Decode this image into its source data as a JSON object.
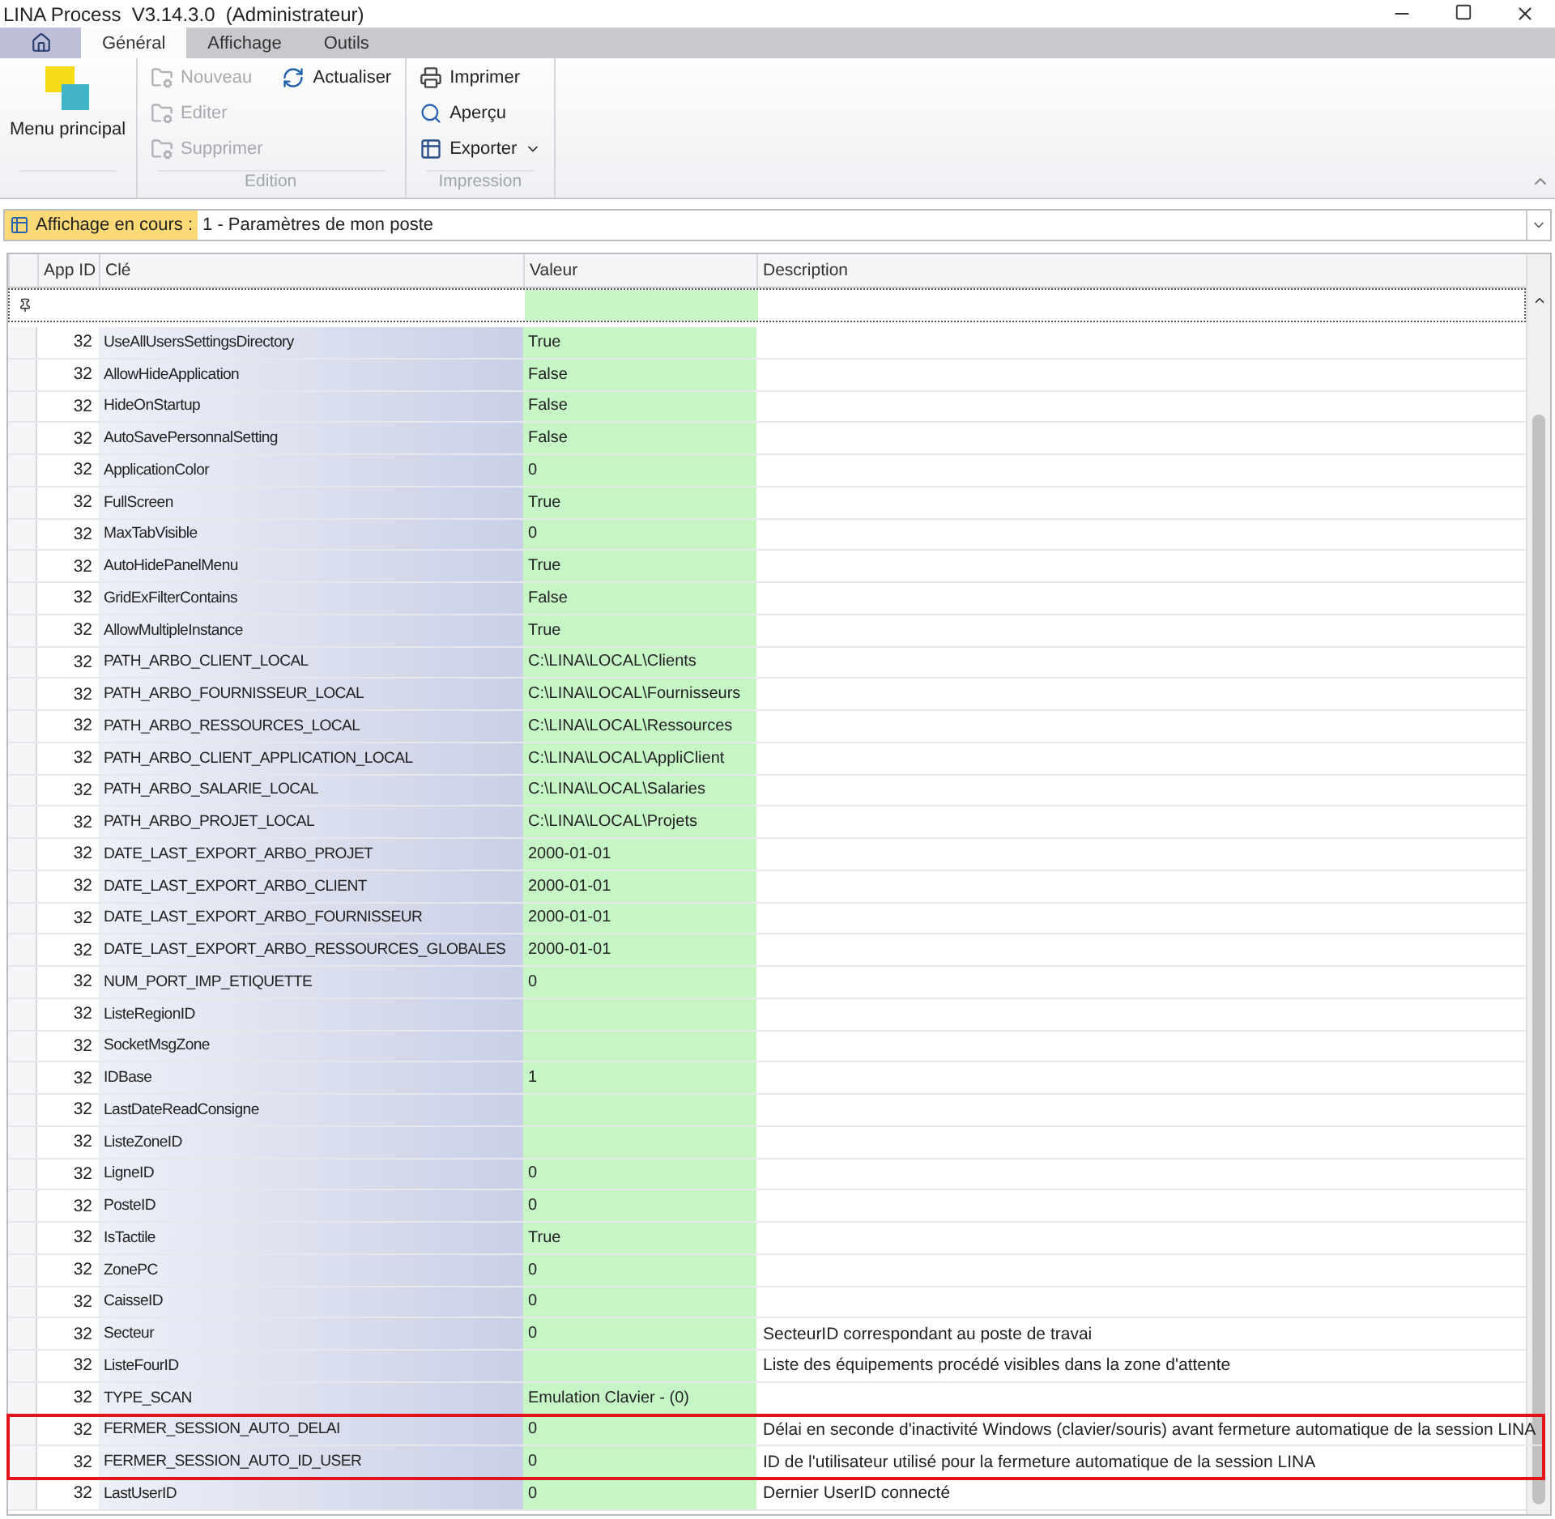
{
  "window": {
    "title": "LINA Process  V3.14.3.0  (Administrateur)"
  },
  "tabs": [
    {
      "label": "Général",
      "selected": true
    },
    {
      "label": "Affichage",
      "selected": false
    },
    {
      "label": "Outils",
      "selected": false
    }
  ],
  "ribbon": {
    "groups": [
      {
        "buttons": [
          {
            "kind": "large",
            "label": "Menu principal",
            "disabled": false
          }
        ]
      },
      {
        "caption": "Edition",
        "buttons": [
          {
            "kind": "small",
            "label": "Nouveau",
            "disabled": true
          },
          {
            "kind": "small",
            "label": "Editer",
            "disabled": true
          },
          {
            "kind": "small",
            "label": "Supprimer",
            "disabled": true
          },
          {
            "kind": "small",
            "label": "Actualiser",
            "disabled": false
          }
        ]
      },
      {
        "caption": "Impression",
        "buttons": [
          {
            "kind": "small",
            "label": "Imprimer",
            "disabled": false
          },
          {
            "kind": "small",
            "label": "Aperçu",
            "disabled": false
          },
          {
            "kind": "small",
            "label": "Exporter",
            "disabled": false,
            "dropdown": true
          }
        ]
      }
    ]
  },
  "view_bar": {
    "label": "Affichage en cours :",
    "value": "1 - Paramètres de mon poste"
  },
  "table": {
    "columns": [
      "App ID",
      "Clé",
      "Valeur",
      "Description"
    ],
    "rows": [
      {
        "app_id": "32",
        "key": "UseAllUsersSettingsDirectory",
        "value": "True",
        "highlighted": false
      },
      {
        "app_id": "32",
        "key": "AllowHideApplication",
        "value": "False",
        "highlighted": false
      },
      {
        "app_id": "32",
        "key": "HideOnStartup",
        "value": "False",
        "highlighted": false
      },
      {
        "app_id": "32",
        "key": "AutoSavePersonnalSetting",
        "value": "False",
        "highlighted": false
      },
      {
        "app_id": "32",
        "key": "ApplicationColor",
        "value": "0",
        "highlighted": false
      },
      {
        "app_id": "32",
        "key": "FullScreen",
        "value": "True",
        "highlighted": false
      },
      {
        "app_id": "32",
        "key": "MaxTabVisible",
        "value": "0",
        "highlighted": false
      },
      {
        "app_id": "32",
        "key": "AutoHidePanelMenu",
        "value": "True",
        "highlighted": false
      },
      {
        "app_id": "32",
        "key": "GridExFilterContains",
        "value": "False",
        "highlighted": false
      },
      {
        "app_id": "32",
        "key": "AllowMultipleInstance",
        "value": "True",
        "highlighted": false
      },
      {
        "app_id": "32",
        "key": "PATH_ARBO_CLIENT_LOCAL",
        "value": "C:\\LINA\\LOCAL\\Clients",
        "highlighted": false
      },
      {
        "app_id": "32",
        "key": "PATH_ARBO_FOURNISSEUR_LOCAL",
        "value": "C:\\LINA\\LOCAL\\Fournisseurs",
        "highlighted": false
      },
      {
        "app_id": "32",
        "key": "PATH_ARBO_RESSOURCES_LOCAL",
        "value": "C:\\LINA\\LOCAL\\Ressources",
        "highlighted": false
      },
      {
        "app_id": "32",
        "key": "PATH_ARBO_CLIENT_APPLICATION_LOCAL",
        "value": "C:\\LINA\\LOCAL\\AppliClient",
        "highlighted": false
      },
      {
        "app_id": "32",
        "key": "PATH_ARBO_SALARIE_LOCAL",
        "value": "C:\\LINA\\LOCAL\\Salaries",
        "highlighted": false
      },
      {
        "app_id": "32",
        "key": "PATH_ARBO_PROJET_LOCAL",
        "value": "C:\\LINA\\LOCAL\\Projets",
        "highlighted": false
      },
      {
        "app_id": "32",
        "key": "DATE_LAST_EXPORT_ARBO_PROJET",
        "value": "2000-01-01",
        "highlighted": false
      },
      {
        "app_id": "32",
        "key": "DATE_LAST_EXPORT_ARBO_CLIENT",
        "value": "2000-01-01",
        "highlighted": false
      },
      {
        "app_id": "32",
        "key": "DATE_LAST_EXPORT_ARBO_FOURNISSEUR",
        "value": "2000-01-01",
        "highlighted": false
      },
      {
        "app_id": "32",
        "key": "DATE_LAST_EXPORT_ARBO_RESSOURCES_GLOBALES",
        "value": "2000-01-01",
        "highlighted": false
      },
      {
        "app_id": "32",
        "key": "NUM_PORT_IMP_ETIQUETTE",
        "value": "0",
        "highlighted": false
      },
      {
        "app_id": "32",
        "key": "ListeRegionID",
        "highlighted": false
      },
      {
        "app_id": "32",
        "key": "SocketMsgZone",
        "highlighted": false
      },
      {
        "app_id": "32",
        "key": "IDBase",
        "value": "1",
        "highlighted": false
      },
      {
        "app_id": "32",
        "key": "LastDateReadConsigne",
        "highlighted": false
      },
      {
        "app_id": "32",
        "key": "ListeZoneID",
        "highlighted": false
      },
      {
        "app_id": "32",
        "key": "LigneID",
        "value": "0",
        "highlighted": false
      },
      {
        "app_id": "32",
        "key": "PosteID",
        "value": "0",
        "highlighted": false
      },
      {
        "app_id": "32",
        "key": "IsTactile",
        "value": "True",
        "highlighted": false
      },
      {
        "app_id": "32",
        "key": "ZonePC",
        "value": "0",
        "highlighted": false
      },
      {
        "app_id": "32",
        "key": "CaisseID",
        "value": "0",
        "highlighted": false
      },
      {
        "app_id": "32",
        "key": "Secteur",
        "value": "0",
        "description": "SecteurID correspondant au poste de travai",
        "highlighted": false
      },
      {
        "app_id": "32",
        "key": "ListeFourID",
        "description": "Liste des équipements procédé visibles dans la zone d'attente",
        "highlighted": false
      },
      {
        "app_id": "32",
        "key": "TYPE_SCAN",
        "value": "Emulation Clavier - (0)",
        "highlighted": false
      },
      {
        "app_id": "32",
        "key": "FERMER_SESSION_AUTO_DELAI",
        "value": "0",
        "description": "Délai en seconde d'inactivité Windows (clavier/souris) avant fermeture automatique de la session LINA",
        "highlighted": true
      },
      {
        "app_id": "32",
        "key": "FERMER_SESSION_AUTO_ID_USER",
        "value": "0",
        "description": "ID de l'utilisateur utilisé pour la fermeture automatique de la session LINA",
        "highlighted": true
      },
      {
        "app_id": "32",
        "key": "LastUserID",
        "value": "0",
        "description": "Dernier UserID connecté",
        "highlighted": false
      }
    ]
  }
}
